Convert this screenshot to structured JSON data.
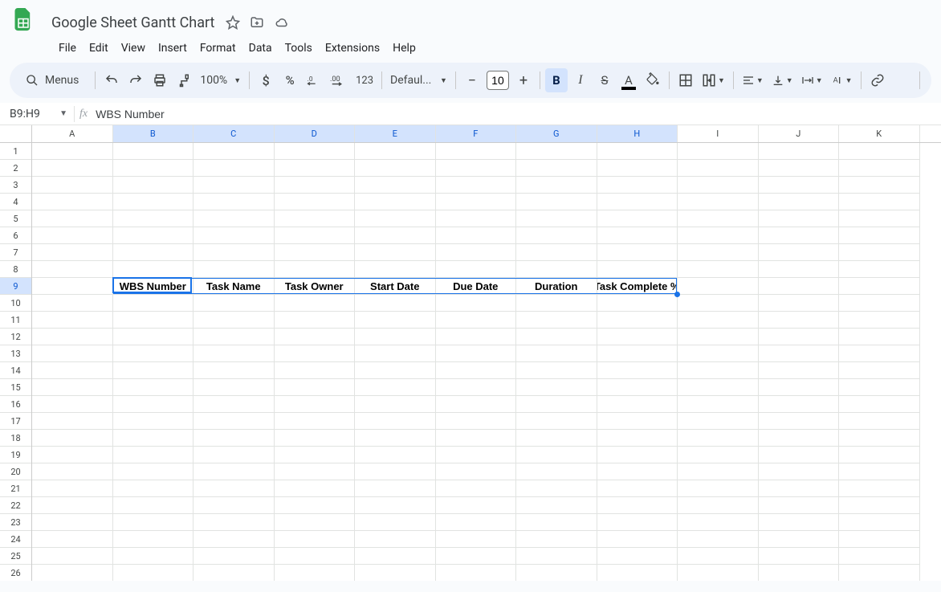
{
  "header": {
    "title": "Google Sheet Gantt Chart",
    "menus": [
      "File",
      "Edit",
      "View",
      "Insert",
      "Format",
      "Data",
      "Tools",
      "Extensions",
      "Help"
    ]
  },
  "toolbar": {
    "menus_label": "Menus",
    "zoom": "100%",
    "font_name": "Defaul...",
    "font_size": "10",
    "number_123": "123"
  },
  "namebox": {
    "ref": "B9:H9",
    "formula": "WBS Number"
  },
  "columns": [
    "A",
    "B",
    "C",
    "D",
    "E",
    "F",
    "G",
    "H",
    "I",
    "J",
    "K"
  ],
  "selected_cols": [
    "B",
    "C",
    "D",
    "E",
    "F",
    "G",
    "H"
  ],
  "row_count": 27,
  "selected_row": 9,
  "data": {
    "row9": {
      "B": "WBS Number",
      "C": "Task Name",
      "D": "Task Owner",
      "E": "Start Date",
      "F": "Due Date",
      "G": "Duration",
      "H": "Task Complete %"
    }
  },
  "selection": {
    "row": 9,
    "colStart": "B",
    "colEnd": "H"
  }
}
